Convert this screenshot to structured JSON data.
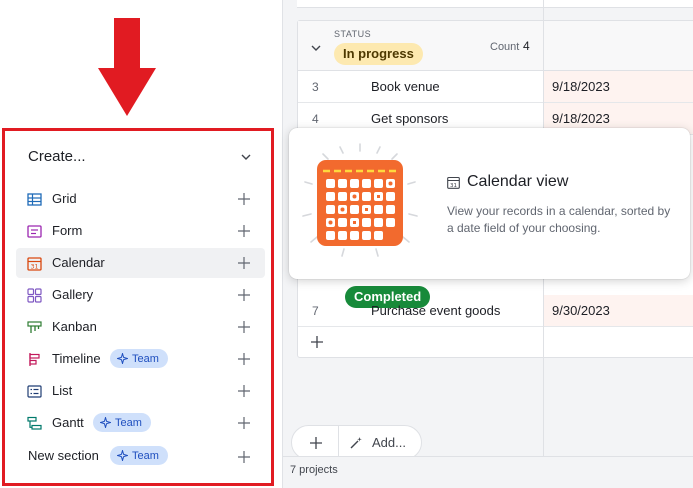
{
  "sidebar": {
    "create_header": "Create...",
    "items": [
      {
        "label": "Grid",
        "icon": "grid-icon",
        "color": "#1f6bb8"
      },
      {
        "label": "Form",
        "icon": "form-icon",
        "color": "#9c27b0"
      },
      {
        "label": "Calendar",
        "icon": "calendar-icon",
        "color": "#d9480f"
      },
      {
        "label": "Gallery",
        "icon": "gallery-icon",
        "color": "#7e57c2"
      },
      {
        "label": "Kanban",
        "icon": "kanban-icon",
        "color": "#2e7d32"
      },
      {
        "label": "Timeline",
        "icon": "timeline-icon",
        "color": "#c2185b",
        "badge": "Team"
      },
      {
        "label": "List",
        "icon": "list-icon",
        "color": "#1f3c73"
      },
      {
        "label": "Gantt",
        "icon": "gantt-icon",
        "color": "#00796b",
        "badge": "Team"
      }
    ],
    "new_section": {
      "label": "New section",
      "badge": "Team"
    },
    "selected_item": "Calendar"
  },
  "grid": {
    "group": {
      "field_label": "STATUS",
      "value": "In progress",
      "count_label": "Count",
      "count": "4"
    },
    "rows": [
      {
        "num": "3",
        "name": "Book venue",
        "date": "9/18/2023"
      },
      {
        "num": "4",
        "name": "Get sponsors",
        "date": "9/18/2023"
      },
      {
        "num": "7",
        "name": "Purchase event goods",
        "date": "9/30/2023"
      }
    ],
    "completed_group": "Completed"
  },
  "tooltip": {
    "title": "Calendar view",
    "description": "View your records in a calendar, sorted by a date field of your choosing."
  },
  "toolbar": {
    "add_label": "Add..."
  },
  "footer": {
    "record_count": "7 projects"
  },
  "colors": {
    "highlight": "#e11b22",
    "arrow": "#e11b22",
    "calendar_orange": "#f26a2e",
    "badge_bg": "#cfe0fb",
    "badge_text": "#1f4fbf",
    "status_yellow": "#fde9b0",
    "completed_green": "#178a3a"
  }
}
